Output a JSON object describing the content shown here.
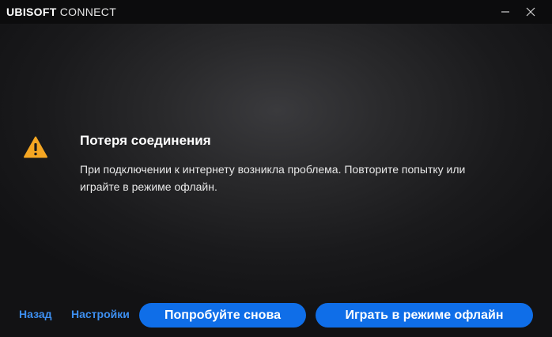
{
  "titlebar": {
    "brand": "UBISOFT",
    "product": " CONNECT",
    "minimize_icon": "minimize-icon",
    "close_icon": "close-icon"
  },
  "dialog": {
    "icon": "warning-icon",
    "icon_color": "#f5a623",
    "title": "Потеря соединения",
    "message": "При подключении к интернету возникла проблема. Повторите попытку или играйте в режиме офлайн."
  },
  "footer": {
    "back_label": "Назад",
    "settings_label": "Настройки",
    "retry_label": "Попробуйте снова",
    "offline_label": "Играть в режиме офлайн"
  },
  "colors": {
    "accent": "#0f6ee8",
    "link": "#3d8ff0",
    "titlebar": "#0c0c0d"
  }
}
